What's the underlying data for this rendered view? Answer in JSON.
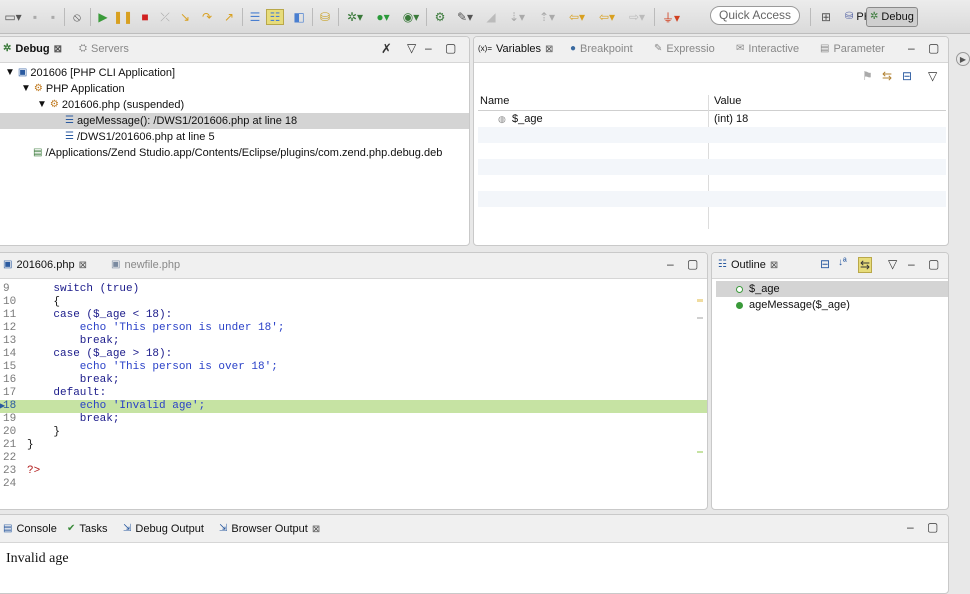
{
  "toolbar": {
    "quick_access": "Quick Access",
    "perspective_php": "PHP",
    "perspective_debug": "Debug"
  },
  "debug_view": {
    "tab_debug": "Debug",
    "tab_servers": "Servers",
    "tree": [
      {
        "label": "201606 [PHP CLI Application]"
      },
      {
        "label": "PHP Application"
      },
      {
        "label": "201606.php (suspended)"
      },
      {
        "label": "ageMessage(): /DWS1/201606.php at line 18"
      },
      {
        "label": "/DWS1/201606.php at line 5"
      },
      {
        "label": "/Applications/Zend Studio.app/Contents/Eclipse/plugins/com.zend.php.debug.deb"
      }
    ]
  },
  "variables_view": {
    "tabs": [
      "Variables",
      "Breakpoint",
      "Expressio",
      "Interactive",
      "Parameter"
    ],
    "col_name": "Name",
    "col_value": "Value",
    "rows": [
      {
        "name": "$_age",
        "value": "(int) 18"
      }
    ]
  },
  "editor": {
    "tab_active": "201606.php",
    "tab_other": "newfile.php",
    "lines": [
      {
        "num": "9",
        "text": "    switch (true)"
      },
      {
        "num": "10",
        "text": "    {"
      },
      {
        "num": "11",
        "text": "    case ($_age < 18):"
      },
      {
        "num": "12",
        "text": "        echo 'This person is under 18';"
      },
      {
        "num": "13",
        "text": "        break;"
      },
      {
        "num": "14",
        "text": "    case ($_age > 18):"
      },
      {
        "num": "15",
        "text": "        echo 'This person is over 18';"
      },
      {
        "num": "16",
        "text": "        break;"
      },
      {
        "num": "17",
        "text": "    default:"
      },
      {
        "num": "18",
        "text": "        echo 'Invalid age';"
      },
      {
        "num": "19",
        "text": "        break;"
      },
      {
        "num": "20",
        "text": "    }"
      },
      {
        "num": "21",
        "text": "}"
      },
      {
        "num": "22",
        "text": ""
      },
      {
        "num": "23",
        "text": "?>"
      },
      {
        "num": "24",
        "text": ""
      }
    ]
  },
  "outline_view": {
    "tab": "Outline",
    "items": [
      {
        "label": "$_age"
      },
      {
        "label": "ageMessage($_age)"
      }
    ]
  },
  "console_view": {
    "tabs": [
      "Console",
      "Tasks",
      "Debug Output",
      "Browser Output"
    ],
    "output": "Invalid age"
  },
  "colors": {
    "highlight_line": "#c6e3a3",
    "selection": "#d4d4d4"
  }
}
